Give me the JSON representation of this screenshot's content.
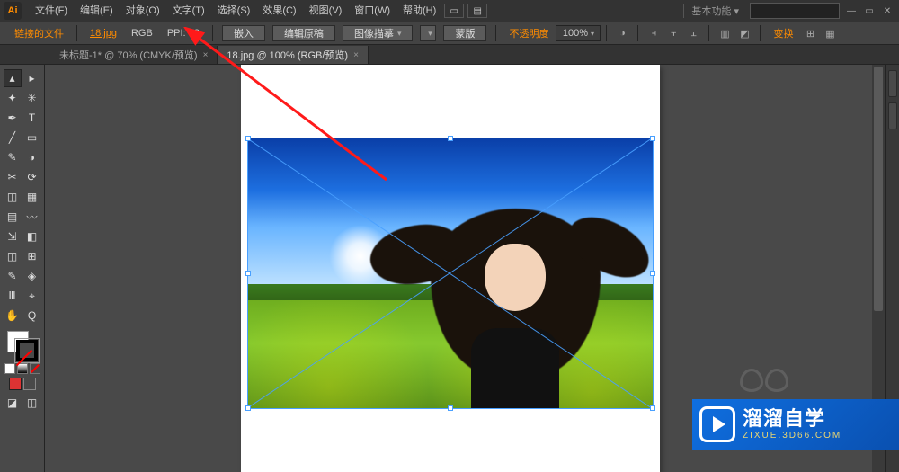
{
  "menubar": {
    "logo": "Ai",
    "items": [
      "文件(F)",
      "编辑(E)",
      "对象(O)",
      "文字(T)",
      "选择(S)",
      "效果(C)",
      "视图(V)",
      "窗口(W)",
      "帮助(H)"
    ],
    "workspace": "基本功能",
    "winmin": "—",
    "winmax": "▭",
    "winclose": "✕"
  },
  "controlbar": {
    "linked_label": "链接的文件",
    "filename": "18.jpg",
    "colormode": "RGB",
    "ppi_label": "PPI:",
    "ppi_value": "72",
    "embed": "嵌入",
    "edit_original": "编辑原稿",
    "image_trace": "图像描摹",
    "mask": "蒙版",
    "opacity_label": "不透明度",
    "zoom": "100%",
    "transform": "变换"
  },
  "tabs": [
    {
      "label": "未标题-1* @ 70% (CMYK/预览)",
      "active": false,
      "close": "×"
    },
    {
      "label": "18.jpg @ 100% (RGB/预览)",
      "active": true,
      "close": "×"
    }
  ],
  "tools": {
    "rows": [
      [
        "▴",
        "▸"
      ],
      [
        "✦",
        "✳"
      ],
      [
        "✒",
        "T"
      ],
      [
        "╱",
        "▭"
      ],
      [
        "✎",
        "◑"
      ],
      [
        "✂",
        "⟳"
      ],
      [
        "◫",
        "▦"
      ],
      [
        "▤",
        "〰"
      ],
      [
        "⇲",
        "◧"
      ],
      [
        "◫",
        "⊞"
      ],
      [
        "✎",
        "◈"
      ],
      [
        "Ⅲ",
        "⌖"
      ],
      [
        "✋",
        "Q"
      ]
    ],
    "modeA": "◪",
    "modeB": "◫"
  },
  "watermark": {
    "title": "溜溜自学",
    "url": "ZIXUE.3D66.COM"
  }
}
